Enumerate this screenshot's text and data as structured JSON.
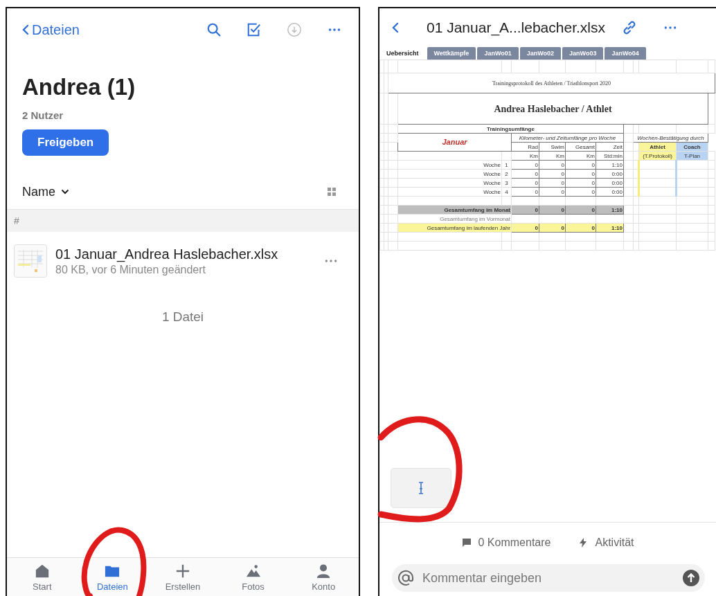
{
  "files_screen": {
    "back_label": "Dateien",
    "title": "Andrea (1)",
    "subtitle": "2 Nutzer",
    "share_button": "Freigeben",
    "sort_label": "Name",
    "section_header": "#",
    "files": [
      {
        "name": "01 Januar_Andrea Haslebacher.xlsx",
        "meta": "80 KB, vor 6 Minuten geändert"
      }
    ],
    "file_count": "1 Datei",
    "tab_bar": [
      {
        "label": "Start",
        "selected": false
      },
      {
        "label": "Dateien",
        "selected": true
      },
      {
        "label": "Erstellen",
        "selected": false
      },
      {
        "label": "Fotos",
        "selected": false
      },
      {
        "label": "Konto",
        "selected": false
      }
    ]
  },
  "viewer_screen": {
    "title": "01 Januar_A...lebacher.xlsx",
    "sheet_tabs": [
      {
        "label": "Uebersicht",
        "selected": true
      },
      {
        "label": "Wettkämpfe",
        "selected": false
      },
      {
        "label": "JanWo01",
        "selected": false
      },
      {
        "label": "JanWo02",
        "selected": false
      },
      {
        "label": "JanWo03",
        "selected": false
      },
      {
        "label": "JanWo04",
        "selected": false
      }
    ],
    "sheet": {
      "title": "Trainingsprotokoll des Athleten / Triathlonsport 2020",
      "heading": "Andrea Haslebacher / Athlet",
      "section": "Trainingsumfänge",
      "month": "Januar",
      "group_header": "Kilometer- und Zeitumfänge pro Woche",
      "columns": [
        {
          "label": "Rad",
          "unit": "Km"
        },
        {
          "label": "Swim",
          "unit": "Km"
        },
        {
          "label": "Gesamt",
          "unit": "Km"
        },
        {
          "label": "Zeit",
          "unit": "Std:min"
        }
      ],
      "weeks": [
        {
          "label": "Woche",
          "number": "1",
          "values": [
            "0",
            "0",
            "0",
            "1:10"
          ]
        },
        {
          "label": "Woche",
          "number": "2",
          "values": [
            "0",
            "0",
            "0",
            "0:00"
          ]
        },
        {
          "label": "Woche",
          "number": "3",
          "values": [
            "0",
            "0",
            "0",
            "0:00"
          ]
        },
        {
          "label": "Woche",
          "number": "4",
          "values": [
            "0",
            "0",
            "0",
            "0:00"
          ]
        }
      ],
      "totals": [
        {
          "kind": "month",
          "label": "Gesamtumfang im Monat",
          "values": [
            "0",
            "0",
            "0",
            "1:10"
          ]
        },
        {
          "kind": "previous",
          "label": "Gesamtumfang im Vormonat"
        },
        {
          "kind": "year",
          "label": "Gesamtumfang im laufenden Jahr",
          "values": [
            "0",
            "0",
            "0",
            "1:10"
          ]
        }
      ],
      "confirmation": {
        "header": "Wochen-Bestätigung durch",
        "athlete": "Athlet",
        "athlete_sub": "(T.Protokoll)",
        "coach": "Coach",
        "coach_sub": "T-Plan"
      }
    },
    "comments_label": "0 Kommentare",
    "activity_label": "Aktivität",
    "comment_field": {
      "placeholder": "Kommentar eingeben"
    }
  }
}
